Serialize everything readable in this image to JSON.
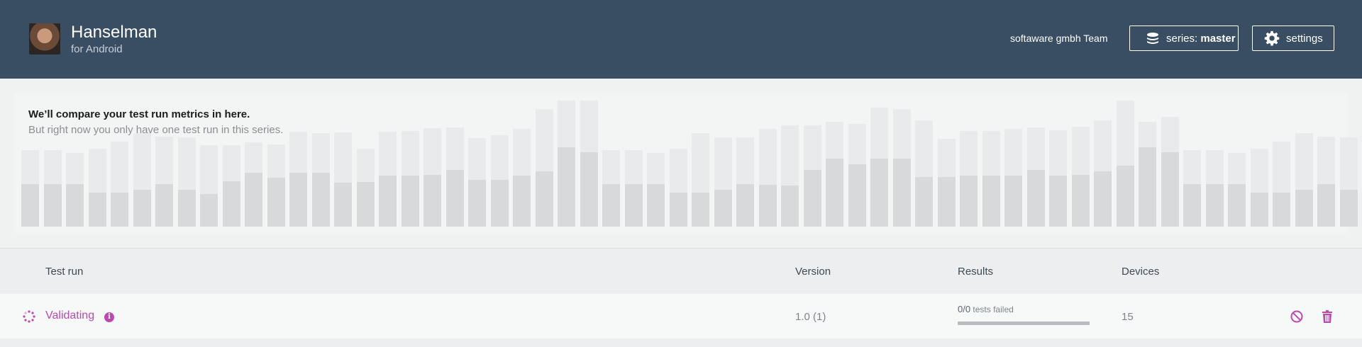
{
  "header": {
    "app_name": "Hanselman",
    "platform": "for Android",
    "team": "softaware gmbh Team",
    "series_label": "series:",
    "series_value": "master",
    "settings_label": "settings",
    "background_color": "#394d63"
  },
  "metrics": {
    "title": "We’ll compare your test run metrics in here.",
    "subtitle": "But right now you only have one test run in this series.",
    "placeholder_bars": [
      {
        "total": 108,
        "part": 60
      },
      {
        "total": 108,
        "part": 60
      },
      {
        "total": 104,
        "part": 60
      },
      {
        "total": 110,
        "part": 48
      },
      {
        "total": 120,
        "part": 48
      },
      {
        "total": 132,
        "part": 52
      },
      {
        "total": 127,
        "part": 60
      },
      {
        "total": 126,
        "part": 52
      },
      {
        "total": 115,
        "part": 46
      },
      {
        "total": 115,
        "part": 64
      },
      {
        "total": 119,
        "part": 76
      },
      {
        "total": 116,
        "part": 69
      },
      {
        "total": 134,
        "part": 76
      },
      {
        "total": 132,
        "part": 76
      },
      {
        "total": 133,
        "part": 62
      },
      {
        "total": 110,
        "part": 63
      },
      {
        "total": 134,
        "part": 72
      },
      {
        "total": 135,
        "part": 72
      },
      {
        "total": 139,
        "part": 73
      },
      {
        "total": 140,
        "part": 80
      },
      {
        "total": 125,
        "part": 66
      },
      {
        "total": 129,
        "part": 66
      },
      {
        "total": 138,
        "part": 72
      },
      {
        "total": 166,
        "part": 78
      },
      {
        "total": 178,
        "part": 112
      },
      {
        "total": 178,
        "part": 105
      },
      {
        "total": 108,
        "part": 60
      },
      {
        "total": 108,
        "part": 60
      },
      {
        "total": 104,
        "part": 60
      },
      {
        "total": 110,
        "part": 48
      },
      {
        "total": 132,
        "part": 48
      },
      {
        "total": 126,
        "part": 52
      },
      {
        "total": 126,
        "part": 60
      },
      {
        "total": 138,
        "part": 59
      },
      {
        "total": 143,
        "part": 58
      },
      {
        "total": 143,
        "part": 80
      },
      {
        "total": 148,
        "part": 96
      },
      {
        "total": 145,
        "part": 88
      },
      {
        "total": 168,
        "part": 96
      },
      {
        "total": 166,
        "part": 96
      },
      {
        "total": 150,
        "part": 70
      },
      {
        "total": 124,
        "part": 70
      },
      {
        "total": 135,
        "part": 72
      },
      {
        "total": 135,
        "part": 72
      },
      {
        "total": 138,
        "part": 72
      },
      {
        "total": 140,
        "part": 80
      },
      {
        "total": 136,
        "part": 72
      },
      {
        "total": 141,
        "part": 73
      },
      {
        "total": 150,
        "part": 78
      },
      {
        "total": 178,
        "part": 86
      },
      {
        "total": 148,
        "part": 112
      },
      {
        "total": 155,
        "part": 105
      },
      {
        "total": 108,
        "part": 60
      },
      {
        "total": 108,
        "part": 60
      },
      {
        "total": 104,
        "part": 60
      },
      {
        "total": 110,
        "part": 48
      },
      {
        "total": 120,
        "part": 48
      },
      {
        "total": 132,
        "part": 52
      },
      {
        "total": 127,
        "part": 60
      },
      {
        "total": 126,
        "part": 52
      }
    ]
  },
  "table": {
    "headers": {
      "test_run": "Test run",
      "version": "Version",
      "results": "Results",
      "devices": "Devices"
    },
    "rows": [
      {
        "status": "Validating",
        "version": "1.0 (1)",
        "results_count": "0/0",
        "results_label": "tests failed",
        "results_progress": 0,
        "devices": "15"
      }
    ],
    "accent_color": "#b94bb0"
  }
}
